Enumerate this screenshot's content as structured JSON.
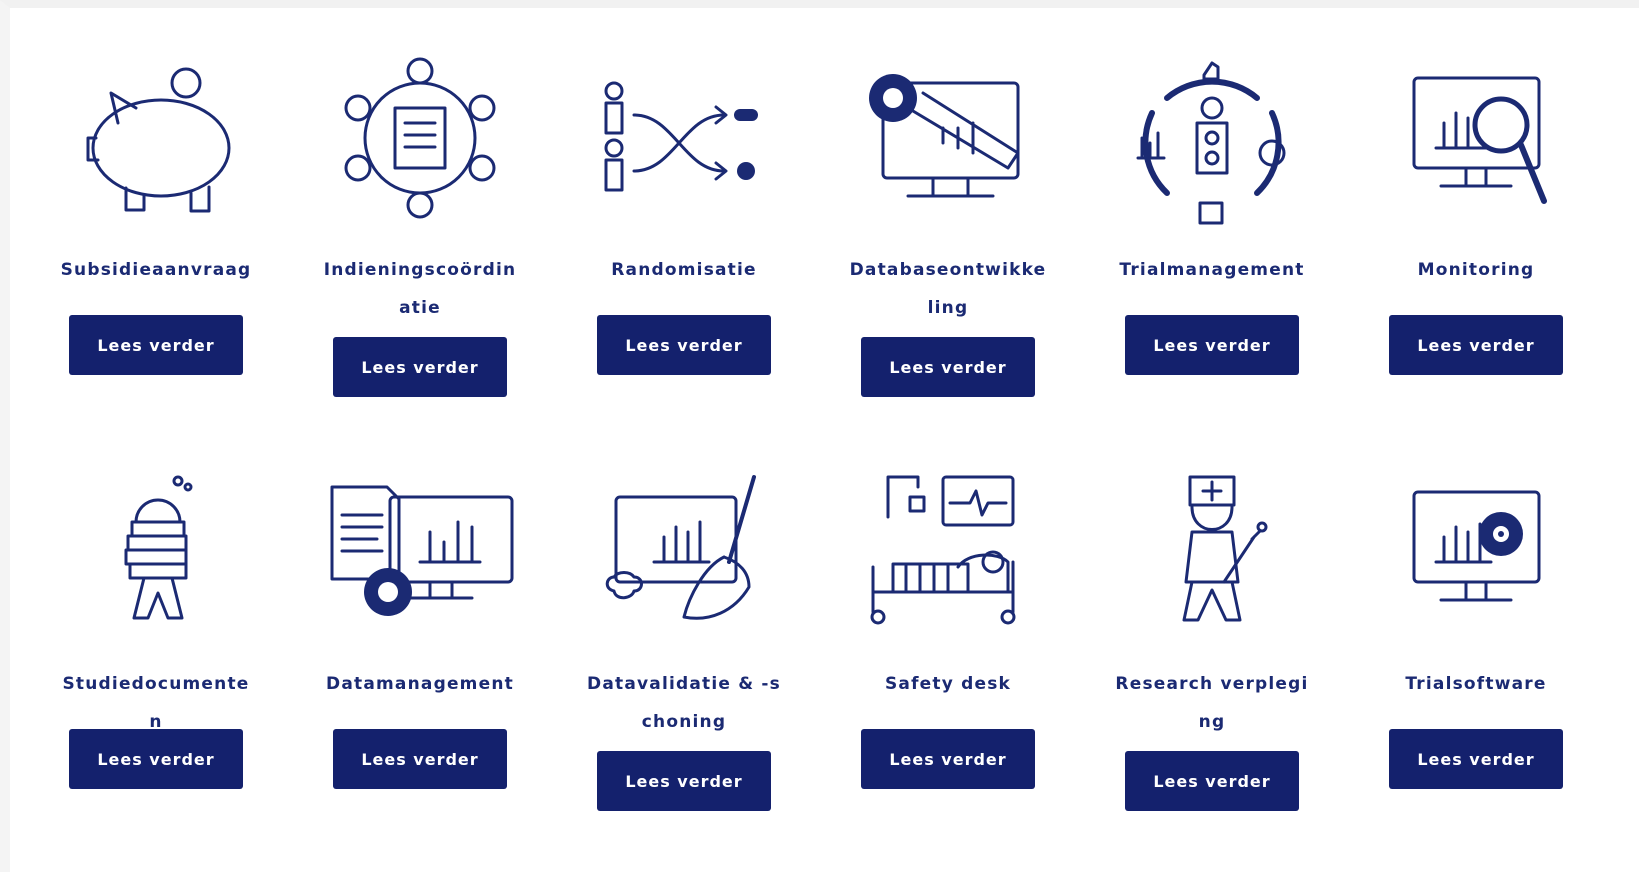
{
  "services": [
    {
      "title": "Subsidieaanvraag",
      "button": "Lees verder",
      "icon": "piggy-bank-icon"
    },
    {
      "title": "Indieningscoördinatie",
      "button": "Lees verder",
      "icon": "team-meeting-icon"
    },
    {
      "title": "Randomisatie",
      "button": "Lees verder",
      "icon": "randomisation-icon"
    },
    {
      "title": "Databaseontwikkeling",
      "button": "Lees verder",
      "icon": "database-development-icon"
    },
    {
      "title": "Trialmanagement",
      "button": "Lees verder",
      "icon": "trial-management-icon"
    },
    {
      "title": "Monitoring",
      "button": "Lees verder",
      "icon": "monitoring-icon"
    },
    {
      "title": "Studiedocumenten",
      "button": "Lees verder",
      "icon": "study-documents-icon"
    },
    {
      "title": "Datamanagement",
      "button": "Lees verder",
      "icon": "data-management-icon"
    },
    {
      "title": "Datavalidatie & -schoning",
      "button": "Lees verder",
      "icon": "data-cleaning-icon"
    },
    {
      "title": "Safety desk",
      "button": "Lees verder",
      "icon": "safety-desk-icon"
    },
    {
      "title": "Research verpleging",
      "button": "Lees verder",
      "icon": "research-nurse-icon"
    },
    {
      "title": "Trialsoftware",
      "button": "Lees verder",
      "icon": "trial-software-icon"
    }
  ],
  "colors": {
    "brand": "#14216d",
    "text": "#1b2a73",
    "background": "#ffffff"
  }
}
